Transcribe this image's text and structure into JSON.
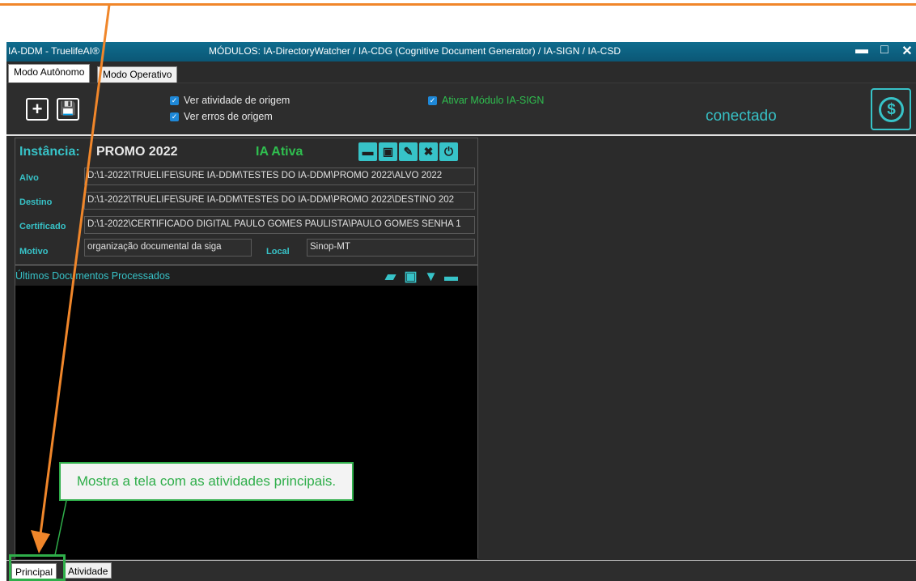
{
  "window": {
    "app_title": "IA-DDM  -  TruelifeAI®",
    "modules_title": "MÓDULOS:  IA-DirectoryWatcher / IA-CDG (Cognitive Document Generator) / IA-SIGN / IA-CSD",
    "minimize": "▬",
    "maximize": "□",
    "close": "✕"
  },
  "top_tabs": [
    "Modo Autônomo",
    "Modo Operativo"
  ],
  "toolbar": {
    "add_label": "+",
    "save_label": "💾",
    "check_activity": "Ver atividade de origem",
    "check_errors": "Ver erros de origem",
    "check_sign": "Ativar Módulo IA-SIGN",
    "status": "conectado",
    "dollar": "$"
  },
  "instance": {
    "label": "Instância:",
    "name": "PROMO 2022",
    "status": "IA Ativa",
    "fields": {
      "alvo_label": "Alvo",
      "alvo_value": "D:\\1-2022\\TRUELIFE\\SURE IA-DDM\\TESTES DO IA-DDM\\PROMO 2022\\ALVO 2022",
      "destino_label": "Destino",
      "destino_value": "D:\\1-2022\\TRUELIFE\\SURE IA-DDM\\TESTES DO IA-DDM\\PROMO 2022\\DESTINO 202",
      "certificado_label": "Certificado",
      "certificado_value": "D:\\1-2022\\CERTIFICADO DIGITAL PAULO GOMES PAULISTA\\PAULO GOMES SENHA 1",
      "motivo_label": "Motivo",
      "motivo_value": "organização documental da siga",
      "local_label": "Local",
      "local_value": "Sinop-MT"
    }
  },
  "docs": {
    "title": "Últimos Documentos Processados"
  },
  "bottom_tabs": [
    "Principal",
    "Atividade"
  ],
  "annotation": {
    "callout": "Mostra a tela com as atividades principais."
  },
  "colors": {
    "accent": "#37c3c8",
    "active_green": "#2fbf4f",
    "arrow": "#f0862a",
    "callout_green": "#2fae4a",
    "titlebar": "#0f6c8e"
  }
}
